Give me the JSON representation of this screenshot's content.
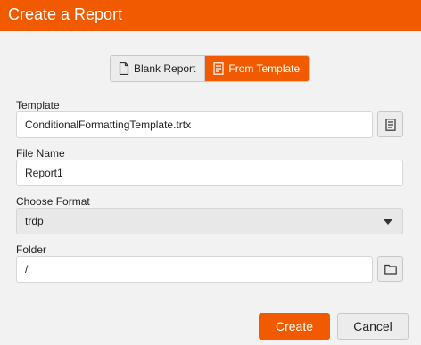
{
  "dialog": {
    "title": "Create a Report"
  },
  "source_toggle": {
    "blank_label": "Blank Report",
    "template_label": "From Template",
    "selected": "From Template"
  },
  "template": {
    "label": "Template",
    "value": "ConditionalFormattingTemplate.trtx",
    "browse_icon": "template-list-icon"
  },
  "file_name": {
    "label": "File Name",
    "value": "Report1"
  },
  "format": {
    "label": "Choose Format",
    "value": "trdp",
    "dropdown_icon": "caret-down-icon"
  },
  "folder": {
    "label": "Folder",
    "value": "/",
    "browse_icon": "folder-icon"
  },
  "actions": {
    "create_label": "Create",
    "cancel_label": "Cancel"
  },
  "colors": {
    "accent": "#f25a00",
    "background": "#f2f2f2"
  }
}
